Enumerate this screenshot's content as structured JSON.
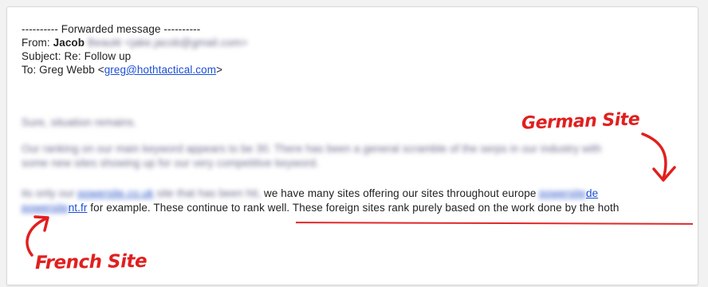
{
  "email": {
    "forward_header": "---------- Forwarded message ----------",
    "from_label": "From:",
    "from_name": "Jacob",
    "from_surname_blurred": "Beaulé",
    "from_email_blurred": "<jake.jacob@gmail.com>",
    "subject_label": "Subject:",
    "subject_value": "Re: Follow up",
    "to_label": "To:",
    "to_name": "Greg Webb",
    "to_email_open": "<",
    "to_email": "greg@hothtactical.com",
    "to_email_close": ">",
    "body_line1_blurred": "Sure, situation remains.",
    "body_line2_blurred": "Our ranking on our main keyword appears to be 30. There has been a general scramble of the serps in our industry with",
    "body_line3_blurred": "some new sites showing up for our very competitive keyword.",
    "body_line4_pre_blurred": "its only our",
    "body_line4_link_blurred": "powersite.co.uk",
    "body_line4_mid_blurred": "site that has been hit,",
    "body_line4_visible": " we have many sites offering our sites throughout europe ",
    "body_line4_link_end": "de",
    "body_line4_link_blurred_end": "powersite",
    "body_line5_link_blurred": "powersite",
    "body_line5_link_end": "nt.fr",
    "body_line5_text": " for example.  These continue to rank well.  These foreign sites rank purely based on the work done by the hoth"
  },
  "annotations": {
    "german": "German Site",
    "french": "French Site",
    "color": "#e11f1f"
  }
}
